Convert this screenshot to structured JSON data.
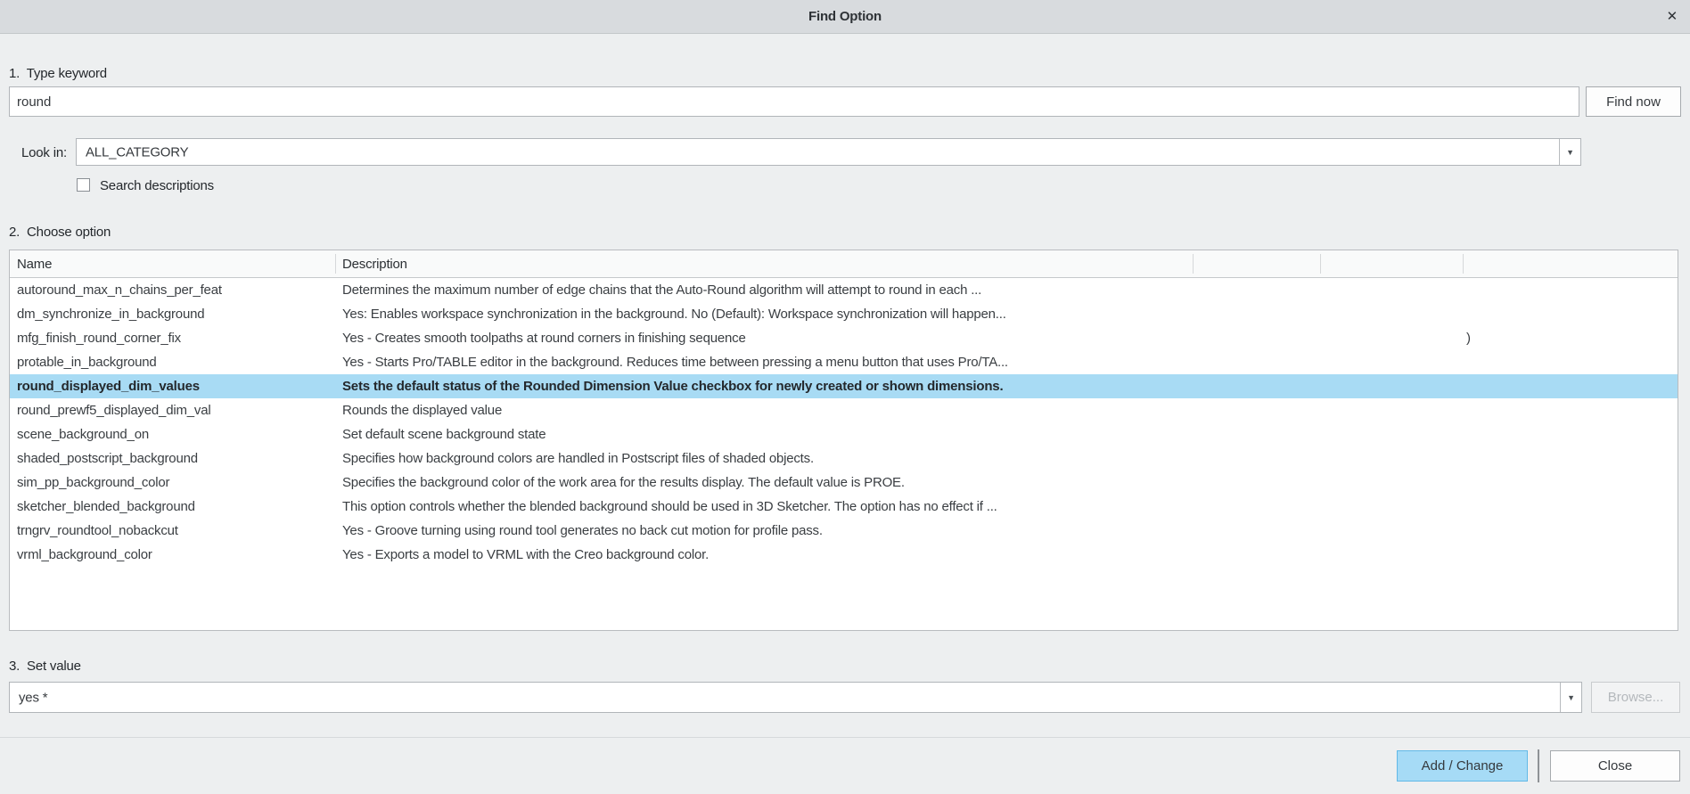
{
  "dialog": {
    "title": "Find Option"
  },
  "icons": {
    "close": "✕",
    "dropdown": "▼"
  },
  "step1": {
    "label": "1.  Type keyword",
    "keyword_value": "round",
    "find_now_label": "Find now",
    "look_in_label": "Look in:",
    "look_in_value": "ALL_CATEGORY",
    "search_descriptions_label": "Search descriptions",
    "search_descriptions_checked": false
  },
  "step2": {
    "label": "2.  Choose option",
    "columns": [
      "Name",
      "Description"
    ],
    "rows": [
      {
        "name": "autoround_max_n_chains_per_feat",
        "description": "Determines the maximum number of edge chains that the Auto-Round algorithm will attempt to round in each ...",
        "selected": false,
        "extra": ""
      },
      {
        "name": "dm_synchronize_in_background",
        "description": "Yes: Enables workspace synchronization in the background. No (Default): Workspace synchronization will happen...",
        "selected": false,
        "extra": ""
      },
      {
        "name": "mfg_finish_round_corner_fix",
        "description": "Yes - Creates smooth toolpaths at round corners in finishing sequence",
        "selected": false,
        "extra": ")"
      },
      {
        "name": "protable_in_background",
        "description": "Yes - Starts Pro/TABLE editor in the background. Reduces time between pressing a menu button that uses Pro/TA...",
        "selected": false,
        "extra": ""
      },
      {
        "name": "round_displayed_dim_values",
        "description": "Sets the default status of the Rounded Dimension Value checkbox for newly created or shown dimensions.",
        "selected": true,
        "extra": ""
      },
      {
        "name": "round_prewf5_displayed_dim_val",
        "description": "Rounds the displayed value",
        "selected": false,
        "extra": ""
      },
      {
        "name": "scene_background_on",
        "description": "Set default scene background state",
        "selected": false,
        "extra": ""
      },
      {
        "name": "shaded_postscript_background",
        "description": "Specifies how background colors are handled in Postscript files of shaded objects.",
        "selected": false,
        "extra": ""
      },
      {
        "name": "sim_pp_background_color",
        "description": "Specifies the background color of the work area for the results display. The default value is PROE.",
        "selected": false,
        "extra": ""
      },
      {
        "name": "sketcher_blended_background",
        "description": "This option controls whether the blended background should be used in 3D Sketcher.  The option has no effect if ...",
        "selected": false,
        "extra": ""
      },
      {
        "name": "trngrv_roundtool_nobackcut",
        "description": "Yes - Groove turning using round tool generates no back cut motion for profile pass.",
        "selected": false,
        "extra": ""
      },
      {
        "name": "vrml_background_color",
        "description": "Yes - Exports a model to VRML with the Creo background color.",
        "selected": false,
        "extra": ""
      }
    ]
  },
  "step3": {
    "label": "3.  Set value",
    "value": "yes *",
    "browse_label": "Browse..."
  },
  "footer": {
    "add_change_label": "Add / Change",
    "close_label": "Close"
  },
  "colors": {
    "selection_bg": "#a8dbf4",
    "accent_button_bg": "#a6dbf6",
    "accent_button_border": "#62b9e7",
    "titlebar_bg": "#d8dbde",
    "dialog_bg": "#edeff0"
  }
}
